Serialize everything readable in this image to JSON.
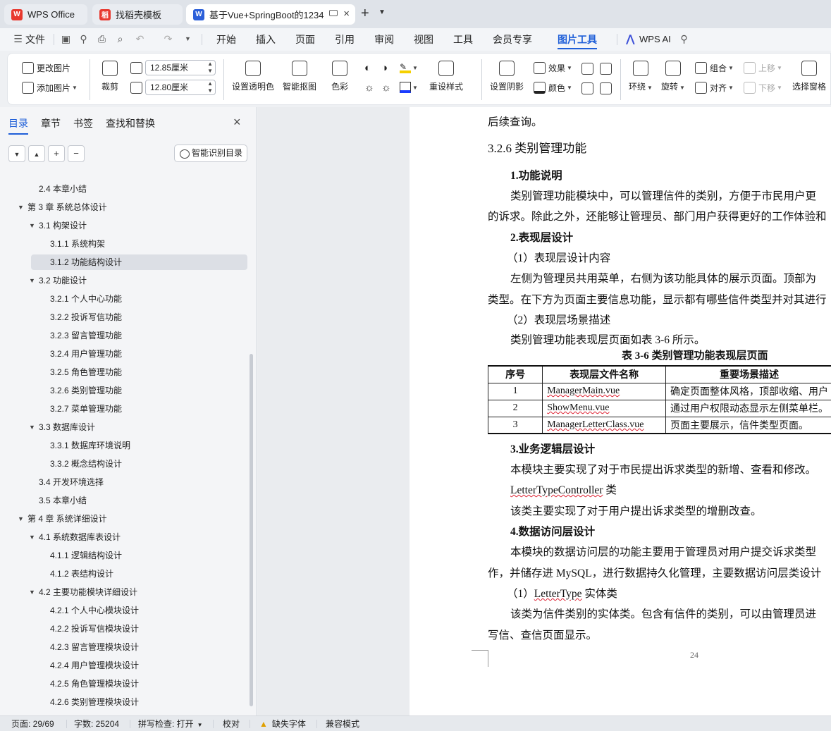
{
  "tabs": [
    {
      "label": "WPS Office",
      "icon": "wps-logo-icon"
    },
    {
      "label": "找稻壳模板",
      "icon": "docer-icon"
    },
    {
      "label": "基于Vue+SpringBoot的1234",
      "icon": "word-doc-icon"
    }
  ],
  "icons": {
    "word_letter": "W",
    "wps_letter": "W",
    "docer_letter": "稻"
  },
  "menu": {
    "file": "文件",
    "items": [
      "开始",
      "插入",
      "页面",
      "引用",
      "审阅",
      "视图",
      "工具",
      "会员专享",
      "图片工具"
    ],
    "wps_ai": "WPS AI"
  },
  "ribbon": {
    "change_image": "更改图片",
    "add_image": "添加图片",
    "crop": "裁剪",
    "height": "12.85厘米",
    "width": "12.80厘米",
    "transparent": "设置透明色",
    "smart_cutout": "智能抠图",
    "color": "色彩",
    "reset_style": "重设样式",
    "set_shadow": "设置阴影",
    "effect": "效果",
    "fill_color": "颜色",
    "wrap": "环绕",
    "rotate": "旋转",
    "group": "组合",
    "align": "对齐",
    "move_up": "上移",
    "move_down": "下移",
    "select_pane": "选择窗格"
  },
  "nav": {
    "tabs": [
      "目录",
      "章节",
      "书签",
      "查找和替换"
    ],
    "smart_toc": "智能识别目录",
    "items": [
      {
        "text": "2.4 本章小结",
        "level": 1,
        "arrow": ""
      },
      {
        "text": "第 3 章  系统总体设计",
        "level": 0,
        "arrow": "▼"
      },
      {
        "text": "3.1 构架设计",
        "level": 1,
        "arrow": "▼"
      },
      {
        "text": "3.1.1 系统构架",
        "level": 2,
        "arrow": ""
      },
      {
        "text": "3.1.2 功能结构设计",
        "level": 2,
        "arrow": "",
        "selected": true
      },
      {
        "text": "3.2 功能设计",
        "level": 1,
        "arrow": "▼"
      },
      {
        "text": "3.2.1 个人中心功能",
        "level": 2,
        "arrow": ""
      },
      {
        "text": "3.2.2 投诉写信功能",
        "level": 2,
        "arrow": ""
      },
      {
        "text": "3.2.3 留言管理功能",
        "level": 2,
        "arrow": ""
      },
      {
        "text": "3.2.4 用户管理功能",
        "level": 2,
        "arrow": ""
      },
      {
        "text": "3.2.5 角色管理功能",
        "level": 2,
        "arrow": ""
      },
      {
        "text": "3.2.6 类别管理功能",
        "level": 2,
        "arrow": ""
      },
      {
        "text": "3.2.7 菜单管理功能",
        "level": 2,
        "arrow": ""
      },
      {
        "text": "3.3 数据库设计",
        "level": 1,
        "arrow": "▼"
      },
      {
        "text": "3.3.1 数据库环境说明",
        "level": 2,
        "arrow": ""
      },
      {
        "text": "3.3.2 概念结构设计",
        "level": 2,
        "arrow": ""
      },
      {
        "text": "3.4 开发环境选择",
        "level": 1,
        "arrow": ""
      },
      {
        "text": "3.5 本章小结",
        "level": 1,
        "arrow": ""
      },
      {
        "text": "第 4 章  系统详细设计",
        "level": 0,
        "arrow": "▼"
      },
      {
        "text": "4.1 系统数据库表设计",
        "level": 1,
        "arrow": "▼"
      },
      {
        "text": "4.1.1 逻辑结构设计",
        "level": 2,
        "arrow": ""
      },
      {
        "text": "4.1.2 表结构设计",
        "level": 2,
        "arrow": ""
      },
      {
        "text": "4.2 主要功能模块详细设计",
        "level": 1,
        "arrow": "▼"
      },
      {
        "text": "4.2.1 个人中心模块设计",
        "level": 2,
        "arrow": ""
      },
      {
        "text": "4.2.2 投诉写信模块设计",
        "level": 2,
        "arrow": ""
      },
      {
        "text": "4.2.3 留言管理模块设计",
        "level": 2,
        "arrow": ""
      },
      {
        "text": "4.2.4 用户管理模块设计",
        "level": 2,
        "arrow": ""
      },
      {
        "text": "4.2.5 角色管理模块设计",
        "level": 2,
        "arrow": ""
      },
      {
        "text": "4.2.6 类别管理模块设计",
        "level": 2,
        "arrow": ""
      }
    ]
  },
  "doc": {
    "line_top": "后续查询。",
    "h_326": "3.2.6 类别管理功能",
    "h_func": "1.功能说明",
    "p_func_1": "类别管理功能模块中，可以管理信件的类别，方便于市民用户更",
    "p_func_2": "的诉求。除此之外，还能够让管理员、部门用户获得更好的工作体验和",
    "h_pres": "2.表现层设计",
    "sub_pres_1": "（1）表现层设计内容",
    "p_pres_1": "左侧为管理员共用菜单，右侧为该功能具体的展示页面。顶部为",
    "p_pres_2": "类型。在下方为页面主要信息功能，显示都有哪些信件类型并对其进行",
    "sub_pres_2": "（2）表现层场景描述",
    "p_pres_3": "类别管理功能表现层页面如表 3-6 所示。",
    "table_caption": "表 3-6 类别管理功能表现层页面",
    "table_headers": [
      "序号",
      "表现层文件名称",
      "重要场景描述"
    ],
    "table_rows": [
      [
        "1",
        "ManagerMain.vue",
        "确定页面整体风格，顶部收缩、用户"
      ],
      [
        "2",
        "ShowMenu.vue",
        "通过用户权限动态显示左侧菜单栏。"
      ],
      [
        "3",
        "ManagerLetterClass.vue",
        "页面主要展示，信件类型页面。"
      ]
    ],
    "h_biz": "3.业务逻辑层设计",
    "p_biz_1": "本模块主要实现了对于市民提出诉求类型的新增、查看和修改。",
    "p_biz_cls": "LetterTypeController",
    "p_biz_cls_suffix": " 类",
    "p_biz_2": "该类主要实现了对于用户提出诉求类型的增删改查。",
    "h_data": "4.数据访问层设计",
    "p_data_1": "本模块的数据访问层的功能主要用于管理员对用户提交诉求类型",
    "p_data_2": "作，并储存进 MySQL，进行数据持久化管理，主要数据访问层类设计",
    "sub_data_prefix": "（1）",
    "sub_data_cls": "LetterType",
    "sub_data_suffix": " 实体类",
    "p_data_3": "该类为信件类别的实体类。包含有信件的类别，可以由管理员进",
    "p_data_4": "写信、查信页面显示。",
    "page_number": "24"
  },
  "status": {
    "page": "页面: 29/69",
    "words": "字数: 25204",
    "spell": "拼写检查: 打开",
    "proof": "校对",
    "missing_font": "缺失字体",
    "compat": "兼容模式"
  },
  "colors": {
    "accent": "#1f5fd8",
    "wps_red": "#e8392f",
    "word_blue": "#2b5fd9"
  }
}
